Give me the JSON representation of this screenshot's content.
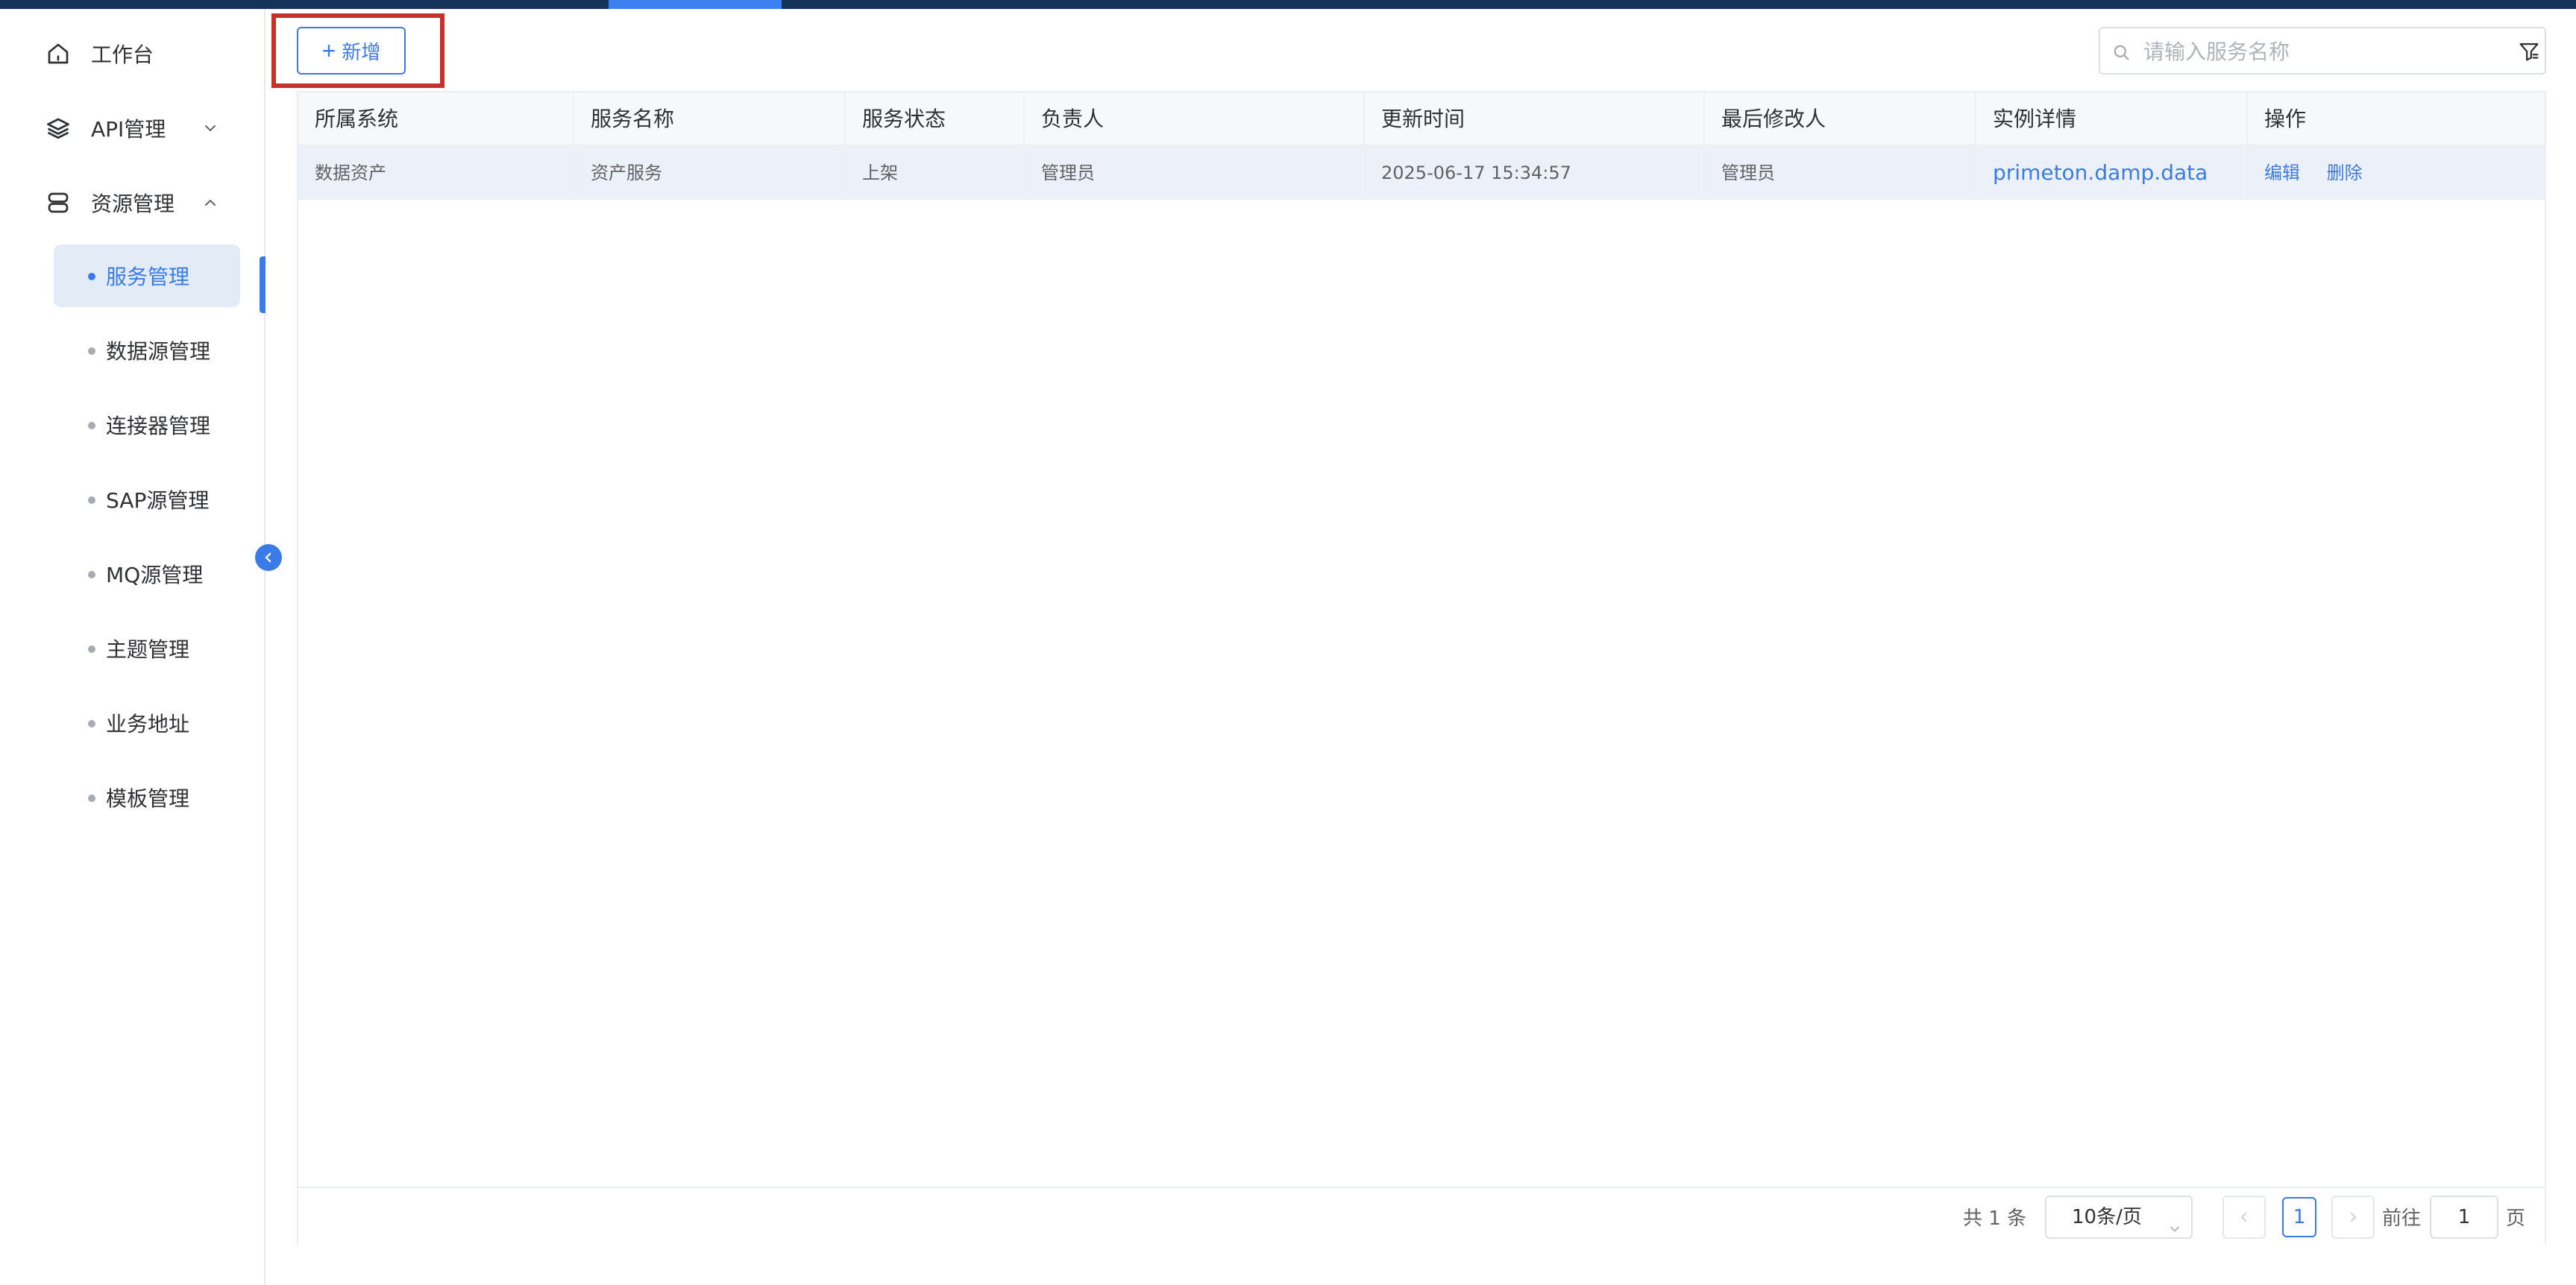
{
  "colors": {
    "accent": "#3a7be8",
    "highlight_border": "#c8302a",
    "topbar": "#14325a",
    "active_bg": "#e3ebf7",
    "row_bg": "#ecf1f9"
  },
  "sidebar": {
    "menu": [
      {
        "label": "工作台",
        "icon": "home-icon"
      },
      {
        "label": "API管理",
        "icon": "layers-icon",
        "arrow": "chevron-down-icon"
      },
      {
        "label": "资源管理",
        "icon": "database-icon",
        "arrow": "chevron-up-icon"
      }
    ],
    "sub_items": [
      {
        "label": "服务管理",
        "active": true
      },
      {
        "label": "数据源管理"
      },
      {
        "label": "连接器管理"
      },
      {
        "label": "SAP源管理"
      },
      {
        "label": "MQ源管理"
      },
      {
        "label": "主题管理"
      },
      {
        "label": "业务地址"
      },
      {
        "label": "模板管理"
      }
    ],
    "collapse_icon": "chevron-left-icon"
  },
  "toolbar": {
    "add_label": "新增",
    "add_icon": "plus-icon",
    "search_placeholder": "请输入服务名称",
    "search_icon": "search-icon",
    "filter_icon": "filter-icon"
  },
  "table": {
    "columns": [
      "所属系统",
      "服务名称",
      "服务状态",
      "负责人",
      "更新时间",
      "最后修改人",
      "实例详情",
      "操作"
    ],
    "rows": [
      {
        "system": "数据资产",
        "name": "资产服务",
        "status": "上架",
        "owner": "管理员",
        "updated": "2025-06-17 15:34:57",
        "modifier": "管理员",
        "instance": "primeton.damp.data",
        "edit": "编辑",
        "delete": "删除"
      }
    ]
  },
  "pagination": {
    "total_text": "共 1 条",
    "page_size": "10条/页",
    "current_page": "1",
    "goto_label": "前往",
    "goto_value": "1",
    "page_suffix": "页"
  }
}
